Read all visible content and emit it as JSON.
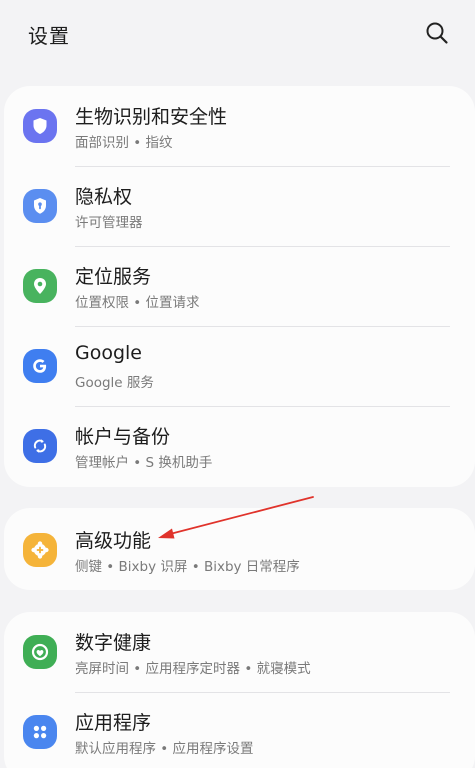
{
  "header": {
    "title": "设置",
    "search_icon": "search-icon"
  },
  "groups": [
    {
      "items": [
        {
          "title": "生物识别和安全性",
          "subtitle": "面部识别 • 指纹",
          "icon": "shield-icon",
          "icon_color": "#6b74f0"
        },
        {
          "title": "隐私权",
          "subtitle": "许可管理器",
          "icon": "privacy-icon",
          "icon_color": "#5b8ef0"
        },
        {
          "title": "定位服务",
          "subtitle": "位置权限 • 位置请求",
          "icon": "location-pin-icon",
          "icon_color": "#48b35e"
        },
        {
          "title": "Google",
          "subtitle": "Google 服务",
          "icon": "google-icon",
          "icon_color": "#3f7ef0"
        },
        {
          "title": "帐户与备份",
          "subtitle": "管理帐户 • S 换机助手",
          "icon": "sync-icon",
          "icon_color": "#3e6fe6"
        }
      ]
    },
    {
      "items": [
        {
          "title": "高级功能",
          "subtitle": "侧键 • Bixby 识屏 • Bixby 日常程序",
          "icon": "gear-plus-icon",
          "icon_color": "#f5b43a"
        }
      ]
    },
    {
      "items": [
        {
          "title": "数字健康",
          "subtitle": "亮屏时间 • 应用程序定时器 • 就寝模式",
          "icon": "digital-wellbeing-icon",
          "icon_color": "#3fae55"
        },
        {
          "title": "应用程序",
          "subtitle": "默认应用程序 • 应用程序设置",
          "icon": "apps-grid-icon",
          "icon_color": "#4a86ef"
        }
      ]
    }
  ],
  "annotation": {
    "color": "#e0332b"
  }
}
